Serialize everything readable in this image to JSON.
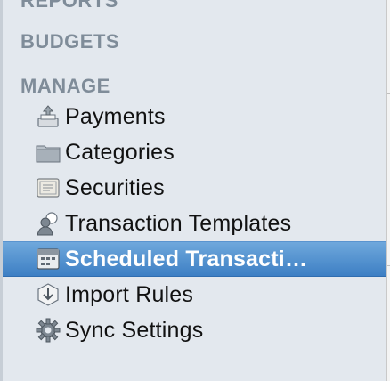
{
  "sidebar": {
    "sections": {
      "reports": "REPORTS",
      "budgets": "BUDGETS",
      "manage": "MANAGE"
    },
    "items": [
      {
        "label": "Payments",
        "icon": "payments-icon"
      },
      {
        "label": "Categories",
        "icon": "folder-icon"
      },
      {
        "label": "Securities",
        "icon": "certificate-icon"
      },
      {
        "label": "Transaction Templates",
        "icon": "person-template-icon"
      },
      {
        "label": "Scheduled Transacti…",
        "icon": "scheduled-calendar-icon",
        "selected": true
      },
      {
        "label": "Import Rules",
        "icon": "import-rules-icon"
      },
      {
        "label": "Sync Settings",
        "icon": "gear-icon"
      }
    ]
  },
  "colors": {
    "sidebar_bg": "#e3e8ee",
    "section_header": "#7f8c99",
    "selection": "#3d7fc4"
  }
}
